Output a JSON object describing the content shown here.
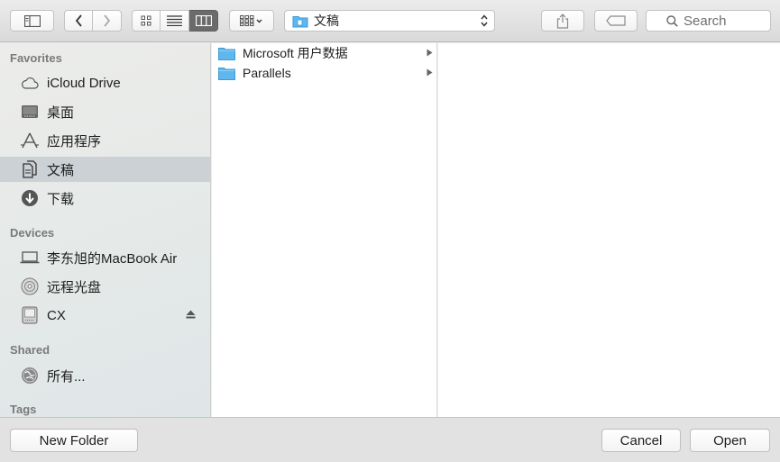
{
  "toolbar": {
    "path_label": "文稿",
    "search_placeholder": "Search"
  },
  "sidebar": {
    "favorites_label": "Favorites",
    "favorites": [
      {
        "label": "iCloud Drive",
        "icon": "cloud-icon"
      },
      {
        "label": "桌面",
        "icon": "desktop-icon"
      },
      {
        "label": "应用程序",
        "icon": "applications-icon"
      },
      {
        "label": "文稿",
        "icon": "documents-icon",
        "selected": true
      },
      {
        "label": "下载",
        "icon": "download-icon"
      }
    ],
    "devices_label": "Devices",
    "devices": [
      {
        "label": "李东旭的MacBook Air",
        "icon": "laptop-icon"
      },
      {
        "label": "远程光盘",
        "icon": "disc-icon"
      },
      {
        "label": "CX",
        "icon": "drive-icon",
        "ejectable": true
      }
    ],
    "shared_label": "Shared",
    "shared": [
      {
        "label": "所有...",
        "icon": "network-icon"
      }
    ],
    "tags_label": "Tags"
  },
  "column1": {
    "items": [
      {
        "label": "Microsoft 用户数据",
        "icon": "folder-icon"
      },
      {
        "label": "Parallels",
        "icon": "folder-icon"
      }
    ]
  },
  "footer": {
    "new_folder_label": "New Folder",
    "cancel_label": "Cancel",
    "open_label": "Open"
  },
  "colors": {
    "selection": "#cbd1d4",
    "folder": "#5fb7ee",
    "active_segment": "#6b6b6b"
  }
}
